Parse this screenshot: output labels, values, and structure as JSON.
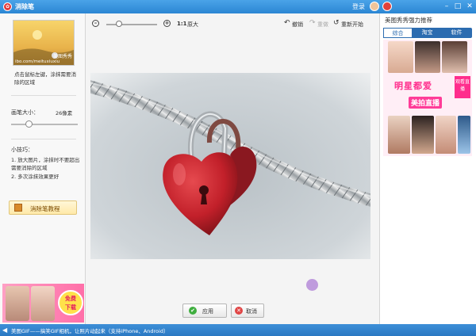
{
  "window": {
    "title": "消除笔",
    "login": "登录"
  },
  "left": {
    "thumb_watermark": "ibo.com/meituxiuxiu",
    "thumb_logo": "美图秀秀",
    "hint": "点击鼠标左键，涂抹需要消除的区域",
    "brush_size_label": "画笔大小：",
    "brush_size_value": "26像素",
    "brush_size_fraction": 0.26,
    "tips_title": "小技巧：",
    "tips": [
      "1. 放大图片，涂抹时不要超出需要消除的区域",
      "2. 多次涂抹效果更好"
    ],
    "tutorial_button": "消除笔教程",
    "ad": {
      "free_line1": "免费",
      "free_line2": "下载"
    }
  },
  "toolbar": {
    "zoom_out_icon": "zoom-out",
    "zoom_in_icon": "zoom-in",
    "zoom_fraction": 0.25,
    "original_size": "原大",
    "original_prefix": "1:1",
    "undo": "撤销",
    "redo": "重做",
    "reset": "重新开始"
  },
  "actions": {
    "apply": "应用",
    "cancel": "取消"
  },
  "right": {
    "title": "美图秀秀强力推荐",
    "tabs": [
      "综合",
      "淘宝",
      "软件"
    ],
    "active_tab": 0,
    "banner_headline": "明星都爱",
    "banner_sub": "美拍直播",
    "banner_tag": "观看直播"
  },
  "status": {
    "text": "美图GIF——搞笑GIF相机，让照片动起来（支持iPhone、Android）"
  },
  "colors": {
    "titlebar": "#2b86d3",
    "accent": "#2c6cb0",
    "apply_icon": "#3fae3f",
    "cancel_icon": "#e04545",
    "heart_lock": "#c2202a"
  }
}
